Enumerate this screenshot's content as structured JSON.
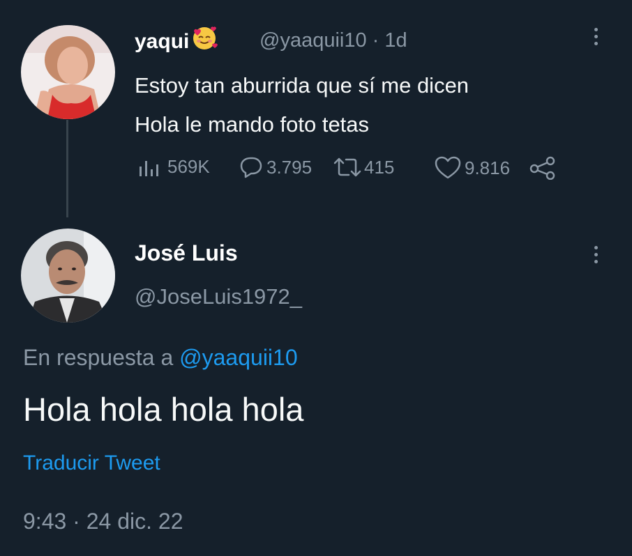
{
  "tweet": {
    "author_name": "yaqui",
    "author_emoji": "smiling-face-with-hearts-emoji",
    "handle": "@yaaquii10",
    "separator": "·",
    "age": "1d",
    "text_line1": "Estoy tan aburrida que sí me dicen",
    "text_line2": "Hola le mando foto tetas",
    "stats": {
      "views": "569K",
      "replies": "3.795",
      "retweets": "415",
      "likes": "9.816"
    },
    "icons": {
      "views": "views-icon",
      "reply": "reply-icon",
      "retweet": "retweet-icon",
      "like": "heart-icon",
      "share": "share-icon",
      "more": "more-vertical-icon"
    }
  },
  "reply": {
    "author_name": "José Luis",
    "handle": "@JoseLuis1972_",
    "replying_to_prefix": "En respuesta a",
    "replying_to_handle": "@yaaquii10",
    "text": "Hola hola hola hola",
    "translate_label": "Traducir Tweet",
    "timestamp": "9:43 · 24 dic. 22"
  },
  "colors": {
    "background": "#15202b",
    "primary_text": "#f7f9f9",
    "secondary_text": "#8b98a5",
    "accent": "#1d9bf0",
    "thread_line": "#38444d"
  }
}
